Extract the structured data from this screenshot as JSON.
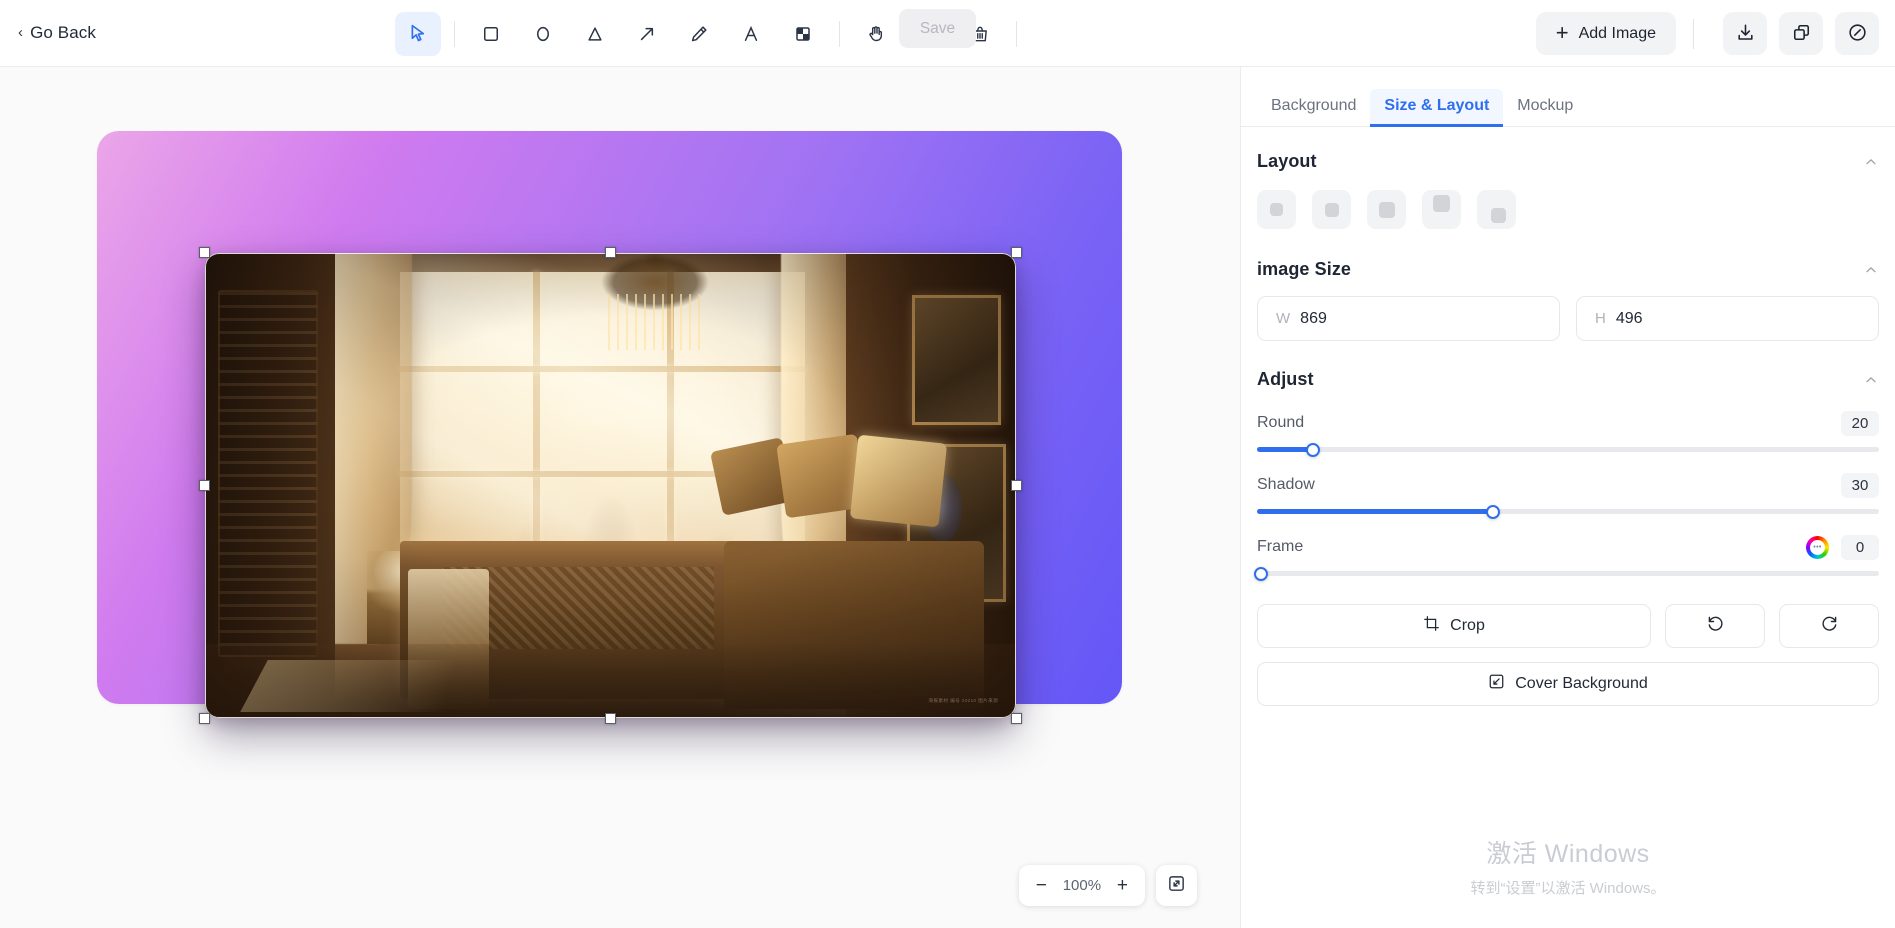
{
  "topbar": {
    "go_back": "Go Back",
    "save_label": "Save",
    "add_image_label": "Add Image",
    "tools": [
      {
        "name": "select-tool",
        "icon": "cursor-icon",
        "active": true
      },
      {
        "name": "rectangle-tool",
        "icon": "square-icon",
        "active": false
      },
      {
        "name": "ellipse-tool",
        "icon": "circle-icon",
        "active": false
      },
      {
        "name": "triangle-tool",
        "icon": "triangle-icon",
        "active": false
      },
      {
        "name": "arrow-tool",
        "icon": "arrow-icon",
        "active": false
      },
      {
        "name": "pencil-tool",
        "icon": "pencil-icon",
        "active": false
      },
      {
        "name": "text-tool",
        "icon": "text-a-icon",
        "active": false
      },
      {
        "name": "mosaic-tool",
        "icon": "mosaic-icon",
        "active": false
      },
      {
        "name": "hand-tool",
        "icon": "hand-icon",
        "active": false
      },
      {
        "name": "undo-tool",
        "icon": "undo-icon",
        "active": false
      },
      {
        "name": "delete-tool",
        "icon": "trash-icon",
        "active": false
      }
    ],
    "actions": [
      {
        "name": "download-button",
        "icon": "download-icon"
      },
      {
        "name": "copy-button",
        "icon": "copy-icon"
      },
      {
        "name": "link-button",
        "icon": "link-icon"
      }
    ]
  },
  "canvas": {
    "zoom_value": "100%",
    "zoom_out": "−",
    "zoom_in": "+",
    "image_watermark": "海报素材 编号 20210 图片来源",
    "background_gradient_from": "#EBA6E8",
    "background_gradient_to": "#6457F7",
    "selected": true
  },
  "panel": {
    "tabs": [
      {
        "label": "Background",
        "active": false
      },
      {
        "label": "Size & Layout",
        "active": true
      },
      {
        "label": "Mockup",
        "active": false
      }
    ],
    "layout": {
      "title": "Layout",
      "options": [
        {
          "name": "layout-option-center-small",
          "index": 1
        },
        {
          "name": "layout-option-center",
          "index": 2
        },
        {
          "name": "layout-option-center-large",
          "index": 3
        },
        {
          "name": "layout-option-top",
          "index": 4
        },
        {
          "name": "layout-option-bottom",
          "index": 5
        }
      ]
    },
    "image_size": {
      "title": "image Size",
      "width_label": "W",
      "width_value": "869",
      "height_label": "H",
      "height_value": "496"
    },
    "adjust": {
      "title": "Adjust",
      "sliders": [
        {
          "name": "round",
          "label": "Round",
          "value": "20",
          "percent": 9,
          "has_color": false
        },
        {
          "name": "shadow",
          "label": "Shadow",
          "value": "30",
          "percent": 38,
          "has_color": false
        },
        {
          "name": "frame",
          "label": "Frame",
          "value": "0",
          "percent": 0,
          "has_color": true
        }
      ]
    },
    "buttons": {
      "crop": "Crop",
      "rotate_left": "rotate-left",
      "rotate_right": "rotate-right",
      "cover_background": "Cover Background"
    }
  },
  "watermark": {
    "line1": "激活 Windows",
    "line2": "转到“设置”以激活 Windows。"
  }
}
